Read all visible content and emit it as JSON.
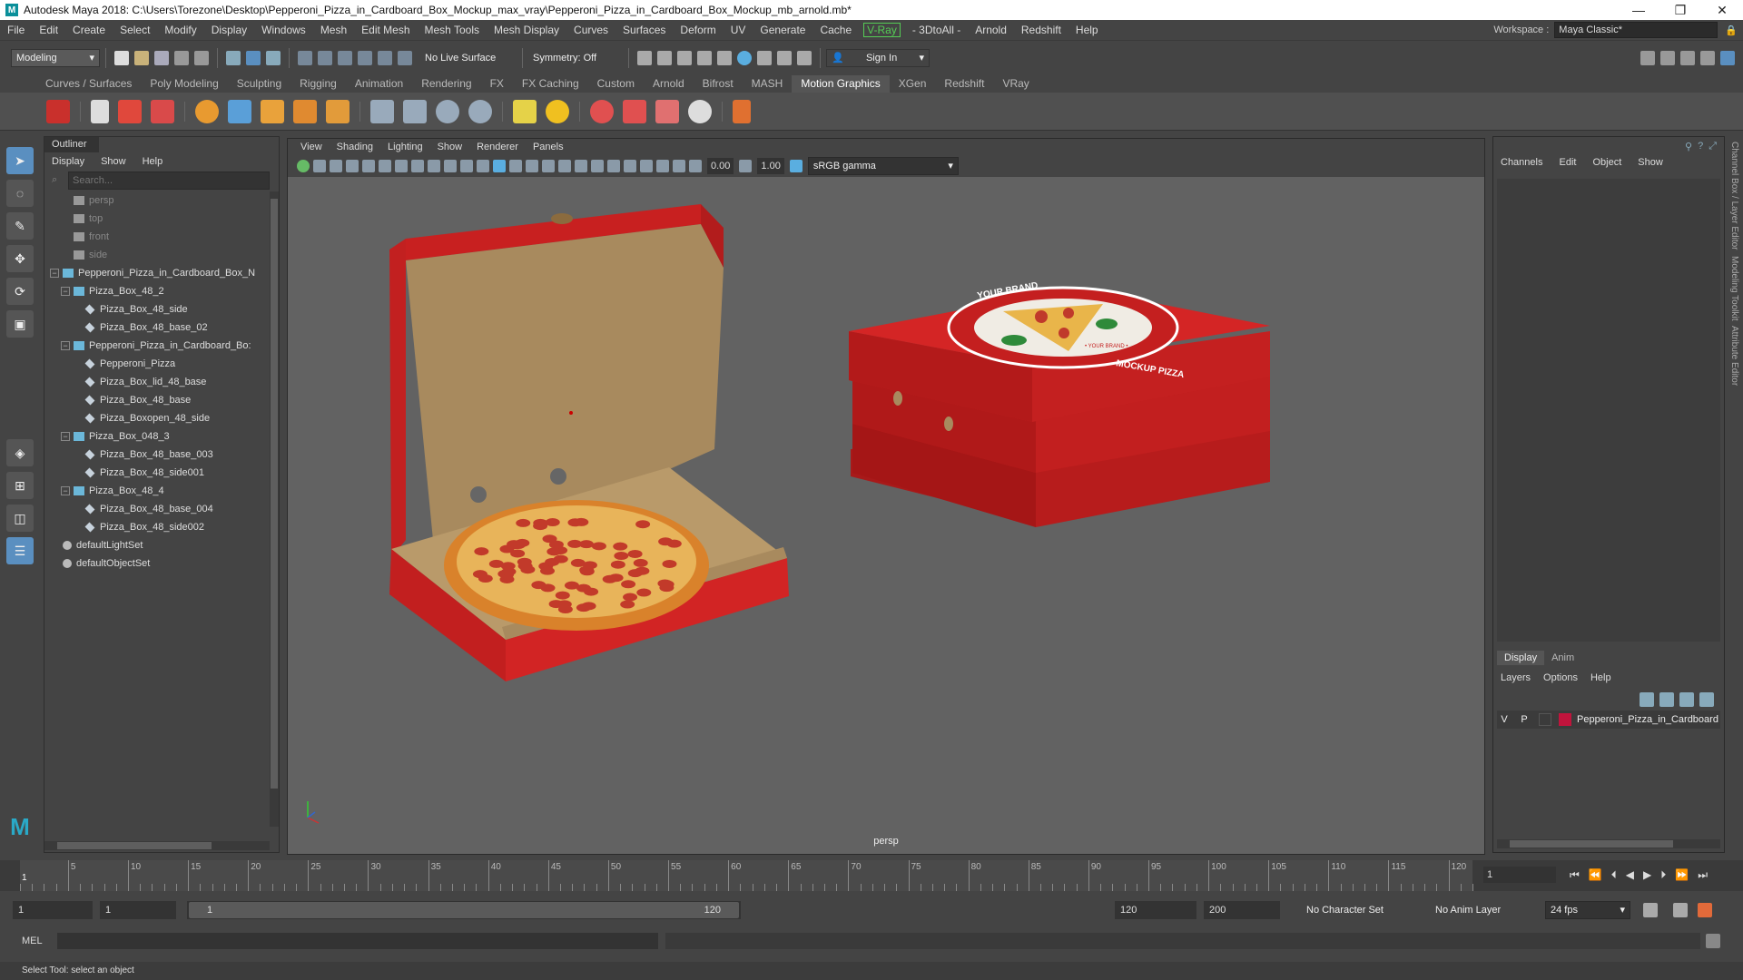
{
  "window": {
    "title": "Autodesk Maya 2018: C:\\Users\\Torezone\\Desktop\\Pepperoni_Pizza_in_Cardboard_Box_Mockup_max_vray\\Pepperoni_Pizza_in_Cardboard_Box_Mockup_mb_arnold.mb*"
  },
  "menubar": {
    "items": [
      "File",
      "Edit",
      "Create",
      "Select",
      "Modify",
      "Display",
      "Windows",
      "Mesh",
      "Edit Mesh",
      "Mesh Tools",
      "Mesh Display",
      "Curves",
      "Surfaces",
      "Deform",
      "UV",
      "Generate",
      "Cache",
      "V-Ray",
      "- 3DtoAll -",
      "Arnold",
      "Redshift",
      "Help"
    ],
    "workspace_label": "Workspace :",
    "workspace_value": "Maya Classic*"
  },
  "statusline": {
    "mode": "Modeling",
    "live_surface": "No Live Surface",
    "symmetry": "Symmetry: Off",
    "sign_in": "Sign In"
  },
  "shelf": {
    "tabs": [
      "Curves / Surfaces",
      "Poly Modeling",
      "Sculpting",
      "Rigging",
      "Animation",
      "Rendering",
      "FX",
      "FX Caching",
      "Custom",
      "Arnold",
      "Bifrost",
      "MASH",
      "Motion Graphics",
      "XGen",
      "Redshift",
      "VRay"
    ],
    "active_tab": "Motion Graphics"
  },
  "outliner": {
    "title": "Outliner",
    "menus": [
      "Display",
      "Show",
      "Help"
    ],
    "search_placeholder": "Search...",
    "items": [
      {
        "label": "persp",
        "type": "camera",
        "depth": 1
      },
      {
        "label": "top",
        "type": "camera",
        "depth": 1
      },
      {
        "label": "front",
        "type": "camera",
        "depth": 1
      },
      {
        "label": "side",
        "type": "camera",
        "depth": 1
      },
      {
        "label": "Pepperoni_Pizza_in_Cardboard_Box_N",
        "type": "group",
        "depth": 0,
        "expanded": true
      },
      {
        "label": "Pizza_Box_48_2",
        "type": "group",
        "depth": 1,
        "expanded": true
      },
      {
        "label": "Pizza_Box_48_side",
        "type": "mesh",
        "depth": 2
      },
      {
        "label": "Pizza_Box_48_base_02",
        "type": "mesh",
        "depth": 2
      },
      {
        "label": "Pepperoni_Pizza_in_Cardboard_Bo:",
        "type": "group",
        "depth": 1,
        "expanded": true
      },
      {
        "label": "Pepperoni_Pizza",
        "type": "mesh",
        "depth": 2
      },
      {
        "label": "Pizza_Box_lid_48_base",
        "type": "mesh",
        "depth": 2
      },
      {
        "label": "Pizza_Box_48_base",
        "type": "mesh",
        "depth": 2
      },
      {
        "label": "Pizza_Boxopen_48_side",
        "type": "mesh",
        "depth": 2
      },
      {
        "label": "Pizza_Box_048_3",
        "type": "group",
        "depth": 1,
        "expanded": true
      },
      {
        "label": "Pizza_Box_48_base_003",
        "type": "mesh",
        "depth": 2
      },
      {
        "label": "Pizza_Box_48_side001",
        "type": "mesh",
        "depth": 2
      },
      {
        "label": "Pizza_Box_48_4",
        "type": "group",
        "depth": 1,
        "expanded": true
      },
      {
        "label": "Pizza_Box_48_base_004",
        "type": "mesh",
        "depth": 2
      },
      {
        "label": "Pizza_Box_48_side002",
        "type": "mesh",
        "depth": 2
      },
      {
        "label": "defaultLightSet",
        "type": "set",
        "depth": 0
      },
      {
        "label": "defaultObjectSet",
        "type": "set",
        "depth": 0
      }
    ]
  },
  "viewport": {
    "menus": [
      "View",
      "Shading",
      "Lighting",
      "Show",
      "Renderer",
      "Panels"
    ],
    "exposure": "0.00",
    "gamma": "1.00",
    "color_space": "sRGB gamma",
    "camera_label": "persp",
    "box_logo_top": "YOUR BRAND",
    "box_logo_bottom": "MOCKUP PIZZA",
    "box_logo_small": "• YOUR BRAND •"
  },
  "channelbox": {
    "menus": [
      "Channels",
      "Edit",
      "Object",
      "Show"
    ],
    "layer_tabs": [
      "Display",
      "Anim"
    ],
    "layer_menus": [
      "Layers",
      "Options",
      "Help"
    ],
    "layer": {
      "v": "V",
      "p": "P",
      "name": "Pepperoni_Pizza_in_Cardboard"
    },
    "side_tabs": [
      "Channel Box / Layer Editor",
      "Modeling Toolkit",
      "Attribute Editor"
    ]
  },
  "timeline": {
    "labels": [
      "5",
      "10",
      "15",
      "20",
      "25",
      "30",
      "35",
      "40",
      "45",
      "50",
      "55",
      "60",
      "65",
      "70",
      "75",
      "80",
      "85",
      "90",
      "95",
      "100",
      "105",
      "110",
      "115",
      "120"
    ],
    "current_marker": "1",
    "current_frame": "1"
  },
  "range": {
    "start": "1",
    "playback_start": "1",
    "slider_start": "1",
    "slider_end": "120",
    "playback_end": "120",
    "end": "200",
    "character_set": "No Character Set",
    "anim_layer": "No Anim Layer",
    "fps": "24 fps"
  },
  "cmdline": {
    "label": "MEL"
  },
  "helpline": {
    "text": "Select Tool: select an object"
  },
  "colors": {
    "box_red": "#c91f1f",
    "accent_blue": "#5a8fc0",
    "cardboard": "#a88a5e"
  }
}
